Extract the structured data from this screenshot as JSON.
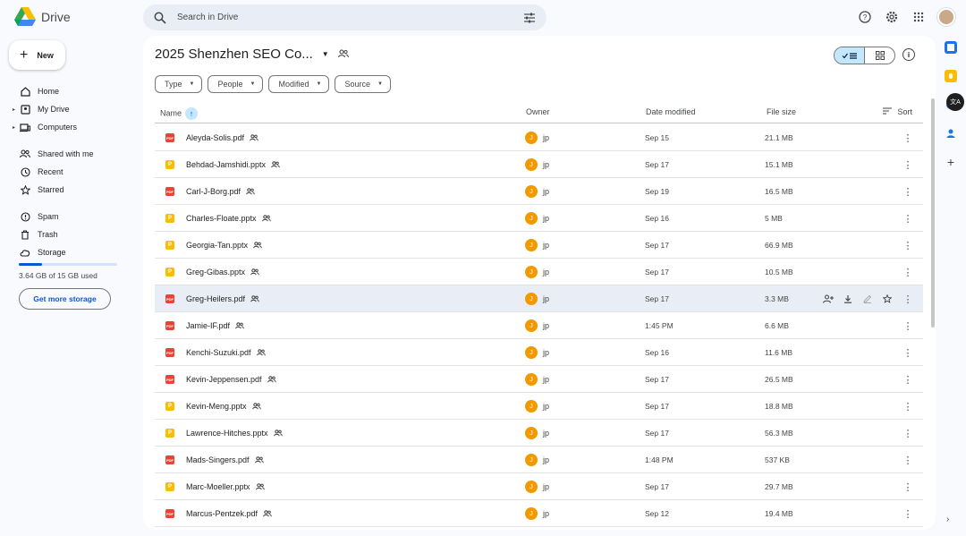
{
  "app": {
    "name": "Drive"
  },
  "search": {
    "placeholder": "Search in Drive"
  },
  "new_button": {
    "label": "New"
  },
  "nav": {
    "home": "Home",
    "my_drive": "My Drive",
    "computers": "Computers",
    "shared": "Shared with me",
    "recent": "Recent",
    "starred": "Starred",
    "spam": "Spam",
    "trash": "Trash",
    "storage": "Storage"
  },
  "storage": {
    "used_text": "3.64 GB of 15 GB used",
    "used_fraction": 0.24,
    "cta": "Get more storage"
  },
  "folder": {
    "title": "2025 Shenzhen SEO Co..."
  },
  "filters": [
    "Type",
    "People",
    "Modified",
    "Source"
  ],
  "columns": {
    "name": "Name",
    "owner": "Owner",
    "date": "Date modified",
    "size": "File size",
    "sort": "Sort"
  },
  "files": [
    {
      "name": "Aleyda-Solis.pdf",
      "type": "pdf",
      "owner": "jp",
      "owner_initial": "J",
      "date": "Sep 15",
      "size": "21.1 MB"
    },
    {
      "name": "Behdad-Jamshidi.pptx",
      "type": "pptx",
      "owner": "jp",
      "owner_initial": "J",
      "date": "Sep 17",
      "size": "15.1 MB"
    },
    {
      "name": "Carl-J-Borg.pdf",
      "type": "pdf",
      "owner": "jp",
      "owner_initial": "J",
      "date": "Sep 19",
      "size": "16.5 MB"
    },
    {
      "name": "Charles-Floate.pptx",
      "type": "pptx",
      "owner": "jp",
      "owner_initial": "J",
      "date": "Sep 16",
      "size": "5 MB"
    },
    {
      "name": "Georgia-Tan.pptx",
      "type": "pptx",
      "owner": "jp",
      "owner_initial": "J",
      "date": "Sep 17",
      "size": "66.9 MB"
    },
    {
      "name": "Greg-Gibas.pptx",
      "type": "pptx",
      "owner": "jp",
      "owner_initial": "J",
      "date": "Sep 17",
      "size": "10.5 MB"
    },
    {
      "name": "Greg-Heilers.pdf",
      "type": "pdf",
      "owner": "jp",
      "owner_initial": "J",
      "date": "Sep 17",
      "size": "3.3 MB",
      "hover": true
    },
    {
      "name": "Jamie-IF.pdf",
      "type": "pdf",
      "owner": "jp",
      "owner_initial": "J",
      "date": "1:45 PM",
      "size": "6.6 MB"
    },
    {
      "name": "Kenchi-Suzuki.pdf",
      "type": "pdf",
      "owner": "jp",
      "owner_initial": "J",
      "date": "Sep 16",
      "size": "11.6 MB"
    },
    {
      "name": "Kevin-Jeppensen.pdf",
      "type": "pdf",
      "owner": "jp",
      "owner_initial": "J",
      "date": "Sep 17",
      "size": "26.5 MB"
    },
    {
      "name": "Kevin-Meng.pptx",
      "type": "pptx",
      "owner": "jp",
      "owner_initial": "J",
      "date": "Sep 17",
      "size": "18.8 MB"
    },
    {
      "name": "Lawrence-Hitches.pptx",
      "type": "pptx",
      "owner": "jp",
      "owner_initial": "J",
      "date": "Sep 17",
      "size": "56.3 MB"
    },
    {
      "name": "Mads-Singers.pdf",
      "type": "pdf",
      "owner": "jp",
      "owner_initial": "J",
      "date": "1:48 PM",
      "size": "537 KB"
    },
    {
      "name": "Marc-Moeller.pptx",
      "type": "pptx",
      "owner": "jp",
      "owner_initial": "J",
      "date": "Sep 17",
      "size": "29.7 MB"
    },
    {
      "name": "Marcus-Pentzek.pdf",
      "type": "pdf",
      "owner": "jp",
      "owner_initial": "J",
      "date": "Sep 12",
      "size": "19.4 MB"
    }
  ],
  "file_icon_text": {
    "pdf": "PDF",
    "pptx": "P"
  },
  "colors": {
    "accent": "#0b57d0",
    "pdf": "#ea4335",
    "pptx": "#fbbc04",
    "avatar": "#f29900",
    "selected_bg": "#c2e7ff"
  },
  "icons": {
    "top": [
      "help-icon",
      "settings-icon",
      "apps-grid-icon",
      "account-avatar"
    ],
    "rail": [
      "calendar-icon",
      "keep-icon",
      "tasks-icon",
      "contacts-icon",
      "add-icon"
    ]
  }
}
